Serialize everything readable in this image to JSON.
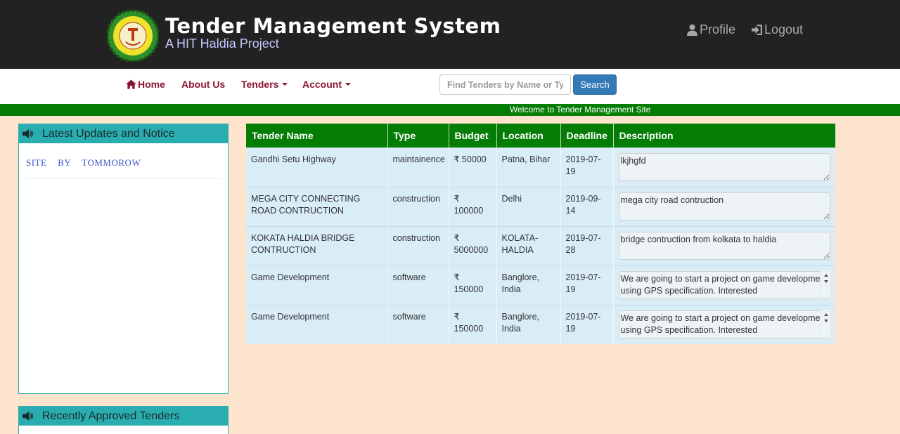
{
  "header": {
    "title": "Tender Management System",
    "subtitle": "A HIT Haldia Project",
    "profile_label": "Profile",
    "logout_label": "Logout",
    "logo_text": "HALDIA INSTITUTE OF TECHNOLOGY"
  },
  "nav": {
    "home": "Home",
    "about": "About Us",
    "tenders": "Tenders",
    "account": "Account",
    "search_placeholder": "Find Tenders by Name or Type",
    "search_button": "Search"
  },
  "marquee": "Welcome to Tender Management Site",
  "sidebar": {
    "updates_title": "Latest Updates and Notice",
    "notice": "SITE BY TOMMOROW",
    "approved_title": "Recently Approved Tenders"
  },
  "table": {
    "headers": [
      "Tender Name",
      "Type",
      "Budget",
      "Location",
      "Deadline",
      "Description"
    ],
    "rows": [
      {
        "name": "Gandhi Setu Highway",
        "type": "maintainence",
        "budget": "₹ 50000",
        "location": "Patna, Bihar",
        "deadline": "2019-07-19",
        "description": "lkjhgfd"
      },
      {
        "name": "MEGA CITY CONNECTING ROAD CONTRUCTION",
        "type": "construction",
        "budget": "₹ 100000",
        "location": "Delhi",
        "deadline": "2019-09-14",
        "description": "mega city road contruction"
      },
      {
        "name": "KOKATA HALDIA BRIDGE CONTRUCTION",
        "type": "construction",
        "budget": "₹ 5000000",
        "location": "KOLATA-HALDIA",
        "deadline": "2019-07-28",
        "description": "bridge contruction from kolkata to haldia"
      },
      {
        "name": "Game Development",
        "type": "software",
        "budget": "₹ 150000",
        "location": "Banglore, India",
        "deadline": "2019-07-19",
        "description": "We are going to start a project on game development using GPS specification. Interested"
      },
      {
        "name": "Game Development",
        "type": "software",
        "budget": "₹ 150000",
        "location": "Banglore, India",
        "deadline": "2019-07-19",
        "description": "We are going to start a project on game development using GPS specification. Interested"
      }
    ]
  },
  "colors": {
    "header_bg": "#222222",
    "nav_text": "#8a1530",
    "green": "#047d04",
    "teal": "#2aadb0",
    "page_bg": "#fde4cc",
    "row_bg": "#d9edf7",
    "search_button": "#337ab7"
  },
  "icons": {
    "logo": "institute-logo-icon",
    "profile": "user-icon",
    "logout": "logout-icon",
    "home": "home-icon",
    "notice": "megaphone-icon"
  }
}
